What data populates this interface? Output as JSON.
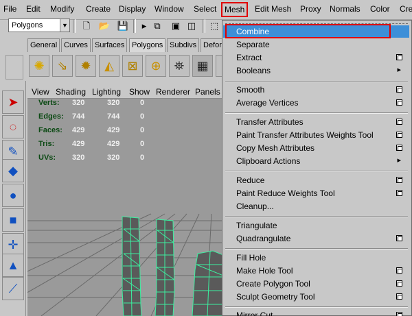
{
  "menubar": {
    "items": [
      "File",
      "Edit",
      "Modify",
      "Create",
      "Display",
      "Window",
      "Select",
      "Mesh",
      "Edit Mesh",
      "Proxy",
      "Normals",
      "Color",
      "Cre"
    ],
    "active_index": 7
  },
  "status_line": {
    "mode": "Polygons"
  },
  "shelf": {
    "tabs": [
      "General",
      "Curves",
      "Surfaces",
      "Polygons",
      "Subdivs",
      "Defor"
    ],
    "selected_tab": "Polygons"
  },
  "viewport": {
    "menu": [
      "View",
      "Shading",
      "Lighting",
      "Show",
      "Renderer",
      "Panels"
    ],
    "hud": [
      {
        "label": "Verts:",
        "v1": "320",
        "v2": "320",
        "v3": "0"
      },
      {
        "label": "Edges:",
        "v1": "744",
        "v2": "744",
        "v3": "0"
      },
      {
        "label": "Faces:",
        "v1": "429",
        "v2": "429",
        "v3": "0"
      },
      {
        "label": "Tris:",
        "v1": "429",
        "v2": "429",
        "v3": "0"
      },
      {
        "label": "UVs:",
        "v1": "320",
        "v2": "320",
        "v3": "0"
      }
    ]
  },
  "mesh_menu": {
    "items": [
      {
        "label": "Combine",
        "highlighted": true
      },
      {
        "label": "Separate"
      },
      {
        "label": "Extract",
        "option_box": true
      },
      {
        "label": "Booleans",
        "submenu": true
      },
      {
        "label": "Smooth",
        "option_box": true
      },
      {
        "label": "Average Vertices",
        "option_box": true
      },
      {
        "label": "Transfer Attributes",
        "option_box": true
      },
      {
        "label": "Paint Transfer Attributes Weights Tool",
        "option_box": true
      },
      {
        "label": "Copy Mesh Attributes",
        "option_box": true
      },
      {
        "label": "Clipboard Actions",
        "submenu": true
      },
      {
        "label": "Reduce",
        "option_box": true
      },
      {
        "label": "Paint Reduce Weights Tool",
        "option_box": true
      },
      {
        "label": "Cleanup...",
        "option_box": false
      },
      {
        "label": "Triangulate"
      },
      {
        "label": "Quadrangulate",
        "option_box": true
      },
      {
        "label": "Fill Hole"
      },
      {
        "label": "Make Hole Tool",
        "option_box": true
      },
      {
        "label": "Create Polygon Tool",
        "option_box": true
      },
      {
        "label": "Sculpt Geometry Tool",
        "option_box": true
      },
      {
        "label": "Mirror Cut",
        "option_box": true
      }
    ],
    "colors": {
      "highlight": "#3d8fd8",
      "annotation": "#e00000"
    }
  }
}
